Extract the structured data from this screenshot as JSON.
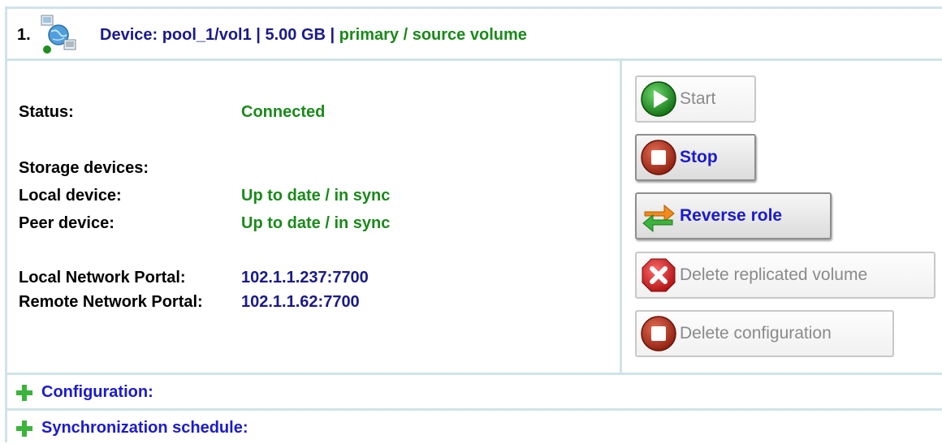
{
  "header": {
    "index": "1.",
    "device_prefix": "Device: pool_1/vol1",
    "separator1": " | ",
    "size": "5.00 GB",
    "separator2": " | ",
    "role": "primary / source volume",
    "icon": "network-device-icon"
  },
  "info": {
    "status_label": "Status:",
    "status_value": "Connected",
    "storage_heading": "Storage devices:",
    "local_device_label": "Local device:",
    "local_device_value": "Up to date / in sync",
    "peer_device_label": "Peer device:",
    "peer_device_value": "Up to date / in sync",
    "local_portal_label": "Local Network Portal:",
    "local_portal_value": "102.1.1.237:7700",
    "remote_portal_label": "Remote Network Portal:",
    "remote_portal_value": "102.1.1.62:7700"
  },
  "buttons": {
    "start": {
      "label": "Start",
      "icon": "play-icon",
      "enabled": false
    },
    "stop": {
      "label": "Stop",
      "icon": "stop-icon",
      "enabled": true
    },
    "reverse": {
      "label": "Reverse role",
      "icon": "reverse-arrows-icon",
      "enabled": true
    },
    "delete_volume": {
      "label": "Delete replicated volume",
      "icon": "delete-x-icon",
      "enabled": false
    },
    "delete_config": {
      "label": "Delete configuration",
      "icon": "stop-icon",
      "enabled": false
    }
  },
  "sections": {
    "configuration": "Configuration:",
    "schedule": "Synchronization schedule:"
  },
  "colors": {
    "border": "#cfe4e8",
    "title_blue": "#1a1a8a",
    "green": "#1a8a1a",
    "link_blue": "#1a1ad0"
  }
}
